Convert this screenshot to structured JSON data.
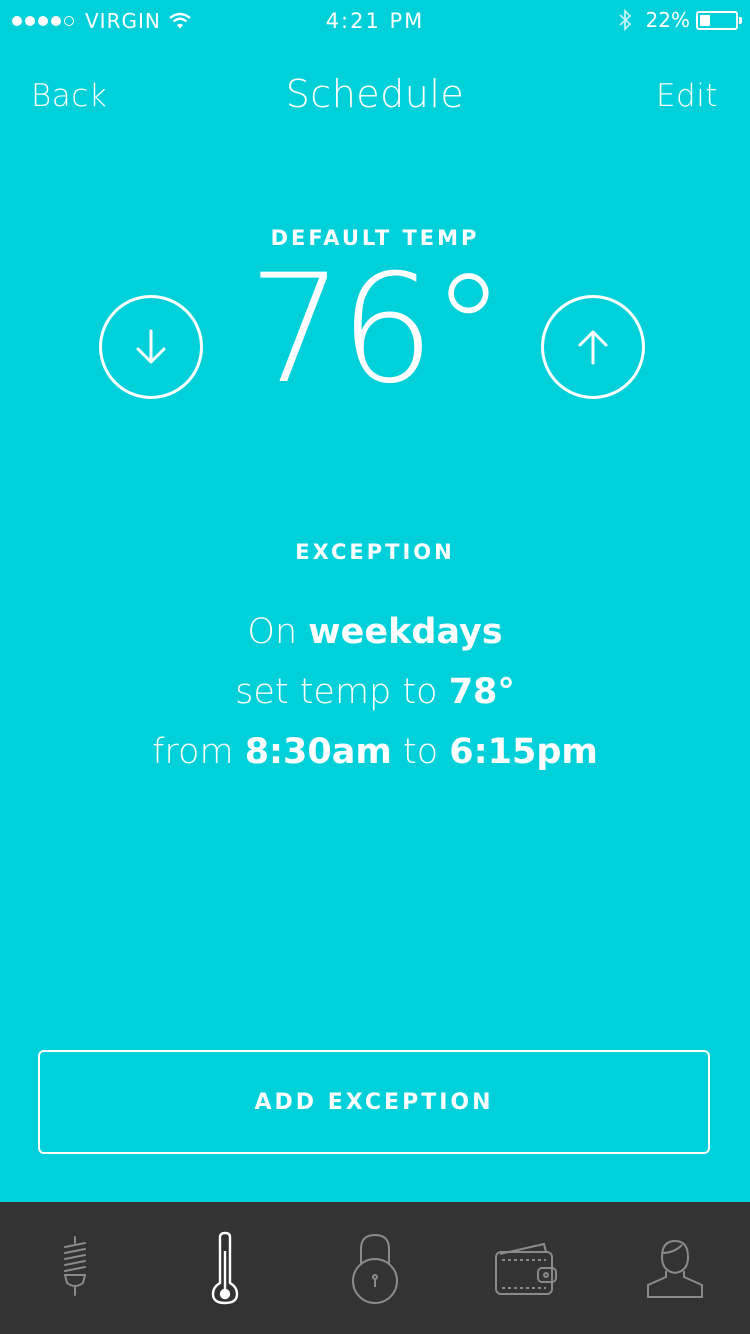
{
  "status_bar": {
    "carrier": "VIRGIN",
    "time": "4:21 PM",
    "battery": "22%",
    "signal_bars": 4
  },
  "nav": {
    "back": "Back",
    "title": "Schedule",
    "edit": "Edit"
  },
  "default_temp": {
    "label": "DEFAULT TEMP",
    "value": "76°"
  },
  "exception": {
    "label": "EXCEPTION",
    "line1_prefix": "On",
    "line1_value": "weekdays",
    "line2_prefix": "set temp to",
    "line2_value": "78°",
    "line3_prefix": "from",
    "line3_start": "8:30am",
    "line3_mid": "to",
    "line3_end": "6:15pm"
  },
  "add_exception": "ADD EXCEPTION",
  "tabs": [
    {
      "icon": "bulb-icon",
      "active": false
    },
    {
      "icon": "thermometer-icon",
      "active": true
    },
    {
      "icon": "lock-icon",
      "active": false
    },
    {
      "icon": "wallet-icon",
      "active": false
    },
    {
      "icon": "user-icon",
      "active": false
    }
  ],
  "colors": {
    "background": "#00d0d9",
    "tabbar": "#333333",
    "tab_inactive": "#8a8a8a",
    "tab_active": "#ffffff"
  }
}
